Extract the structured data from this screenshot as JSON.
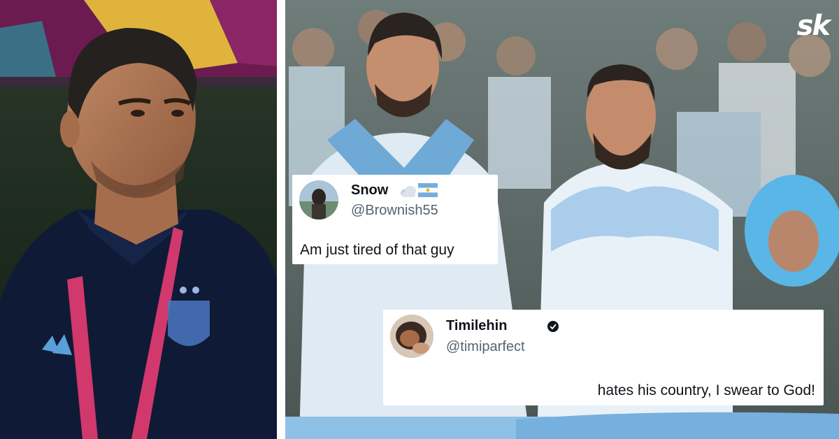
{
  "logo": {
    "text": "sk"
  },
  "tweets": [
    {
      "name": "Snow",
      "handle": "@Brownish55",
      "text": "Am just tired of that guy",
      "name_emojis": [
        "cloud-icon",
        "argentina-flag-icon"
      ]
    },
    {
      "name": "Timilehin",
      "handle": "@timiparfect",
      "text": "hates his country, I swear to God!",
      "badge": "verified-badge-icon"
    }
  ],
  "colors": {
    "argentina_sky_blue": "#74acdf",
    "tweet_handle_gray": "#536471",
    "lanyard_pink": "#d1386b"
  }
}
